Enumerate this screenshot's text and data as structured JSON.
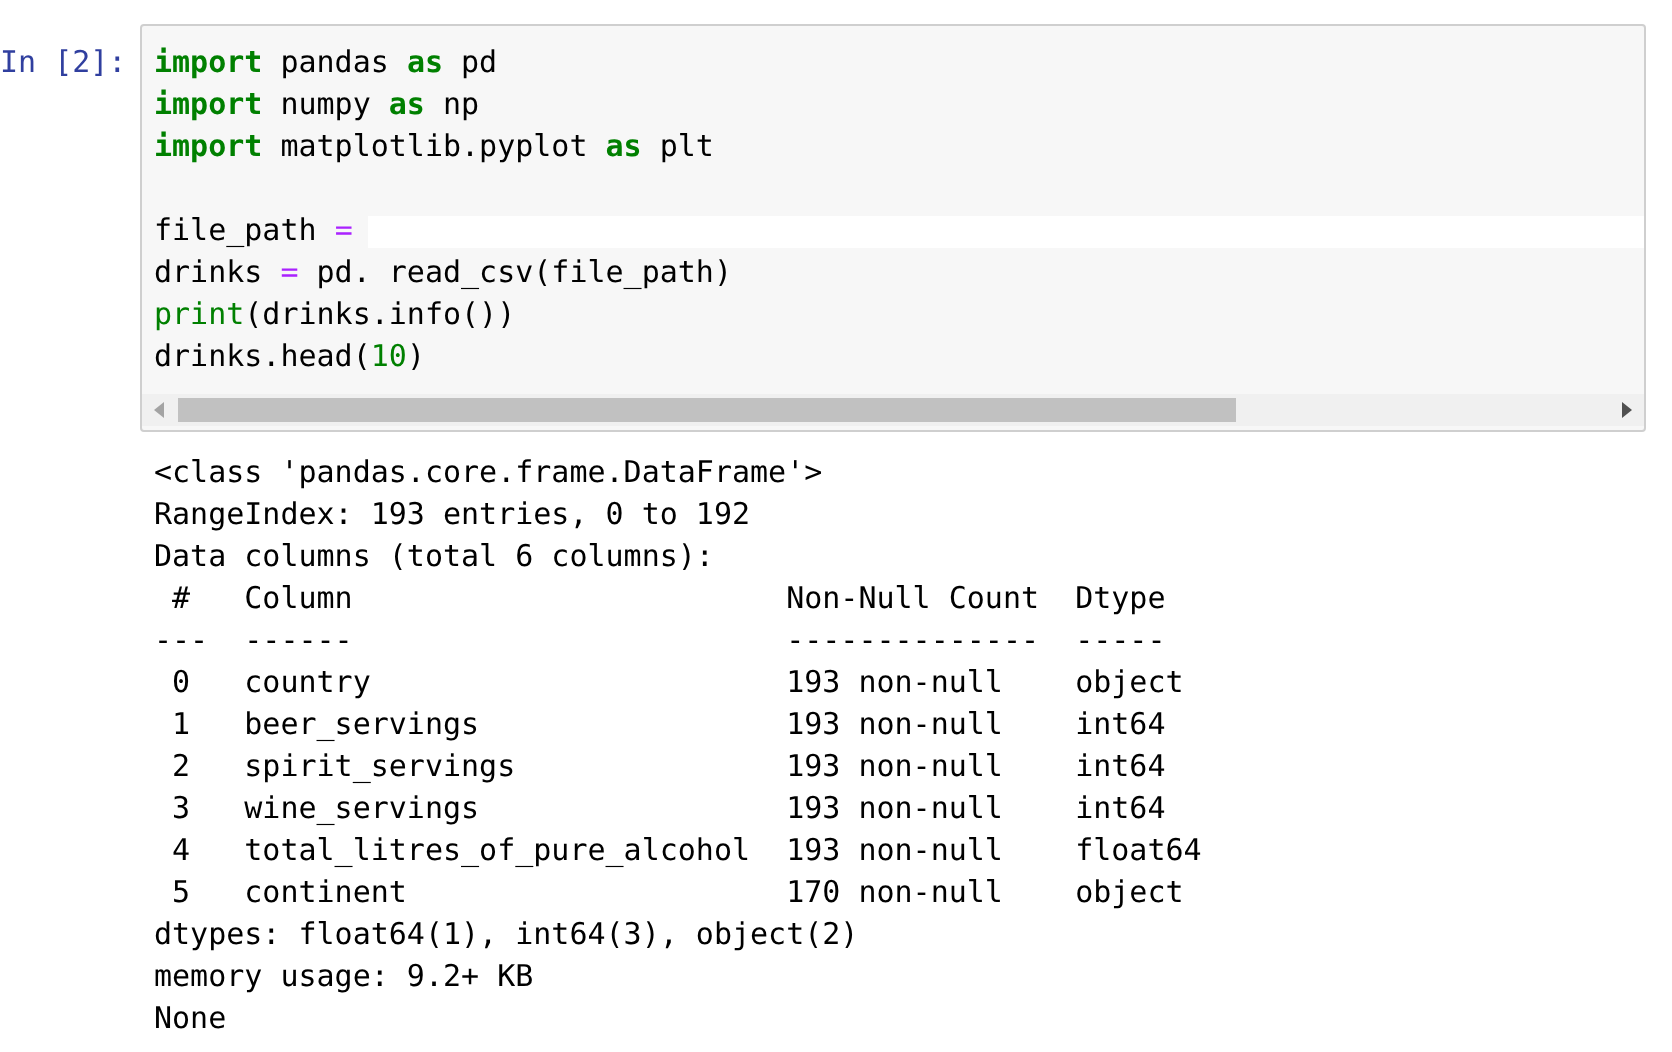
{
  "cell": {
    "prompt": "In [2]:",
    "code_blocks": [
      [
        {
          "tokens": [
            {
              "kind": "keyword",
              "text": "import"
            },
            {
              "kind": "plain",
              "text": " pandas "
            },
            {
              "kind": "keyword",
              "text": "as"
            },
            {
              "kind": "plain",
              "text": " pd"
            }
          ]
        },
        {
          "tokens": [
            {
              "kind": "keyword",
              "text": "import"
            },
            {
              "kind": "plain",
              "text": " numpy "
            },
            {
              "kind": "keyword",
              "text": "as"
            },
            {
              "kind": "plain",
              "text": " np"
            }
          ]
        },
        {
          "tokens": [
            {
              "kind": "keyword",
              "text": "import"
            },
            {
              "kind": "plain",
              "text": " matplotlib.pyplot "
            },
            {
              "kind": "keyword",
              "text": "as"
            },
            {
              "kind": "plain",
              "text": " plt"
            }
          ]
        }
      ],
      [
        {
          "redacted": true,
          "tokens": [
            {
              "kind": "plain",
              "text": "file_path "
            },
            {
              "kind": "operator",
              "text": "="
            }
          ]
        },
        {
          "tokens": [
            {
              "kind": "plain",
              "text": "drinks "
            },
            {
              "kind": "operator",
              "text": "="
            },
            {
              "kind": "plain",
              "text": " pd. read_csv(file_path)"
            }
          ]
        },
        {
          "tokens": [
            {
              "kind": "builtin",
              "text": "print"
            },
            {
              "kind": "plain",
              "text": "(drinks.info())"
            }
          ]
        },
        {
          "tokens": [
            {
              "kind": "plain",
              "text": "drinks.head("
            },
            {
              "kind": "number",
              "text": "10"
            },
            {
              "kind": "plain",
              "text": ")"
            }
          ]
        }
      ]
    ],
    "output_lines": [
      "<class 'pandas.core.frame.DataFrame'>",
      "RangeIndex: 193 entries, 0 to 192",
      "Data columns (total 6 columns):",
      " #   Column                        Non-Null Count  Dtype",
      "---  ------                        --------------  -----",
      " 0   country                       193 non-null    object",
      " 1   beer_servings                 193 non-null    int64",
      " 2   spirit_servings               193 non-null    int64",
      " 3   wine_servings                 193 non-null    int64",
      " 4   total_litres_of_pure_alcohol  193 non-null    float64",
      " 5   continent                     170 non-null    object",
      "dtypes: float64(1), int64(3), object(2)",
      "memory usage: 9.2+ KB",
      "None"
    ]
  }
}
